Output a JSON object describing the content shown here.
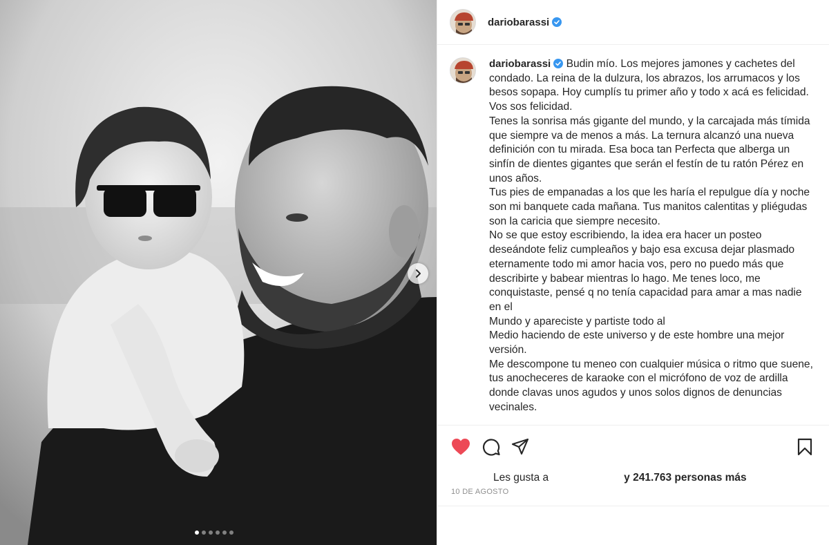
{
  "post": {
    "username": "dariobarassi",
    "verified": true,
    "caption": "Budin mío. Los mejores jamones y cachetes del condado. La reina de la dulzura, los abrazos, los arrumacos y los besos sopapa. Hoy cumplís tu primer año y todo x acá es felicidad. Vos sos felicidad.\nTenes la sonrisa más gigante del mundo, y la carcajada más tímida que siempre va de menos a más. La ternura alcanzó una nueva definición con tu mirada. Esa boca tan Perfecta que alberga un sinfín de dientes gigantes que serán el festín de tu ratón Pérez en unos años.\nTus pies de empanadas a los que les haría el repulgue día y noche son mi banquete cada mañana. Tus manitos calentitas y pliégudas son la caricia que siempre necesito.\nNo se que estoy escribiendo, la idea era hacer un posteo deseándote feliz cumpleaños y bajo esa excusa dejar plasmado eternamente todo mi amor hacia vos, pero no puedo más que describirte y babear mientras lo hago. Me tenes loco, me conquistaste, pensé q no tenía capacidad para amar a mas nadie en el\nMundo y apareciste y partiste todo al\nMedio haciendo de este universo y de este hombre una mejor versión.\nMe descompone tu meneo con cualquier música o ritmo que suene, tus anocheceres de karaoke con el micrófono de voz de ardilla donde clavas unos agudos y unos solos dignos de denuncias vecinales.",
    "likes_prefix": "Les gusta a",
    "likes_count_text": "y 241.763 personas más",
    "date": "10 DE AGOSTO",
    "carousel": {
      "total": 6,
      "active": 1
    }
  },
  "colors": {
    "heart": "#ed4956",
    "verified": "#3897f0",
    "text": "#262626",
    "muted": "#8e8e8e"
  },
  "icons": [
    "heart-icon",
    "comment-icon",
    "share-icon",
    "bookmark-icon",
    "verified-badge-icon",
    "chevron-right-icon"
  ]
}
